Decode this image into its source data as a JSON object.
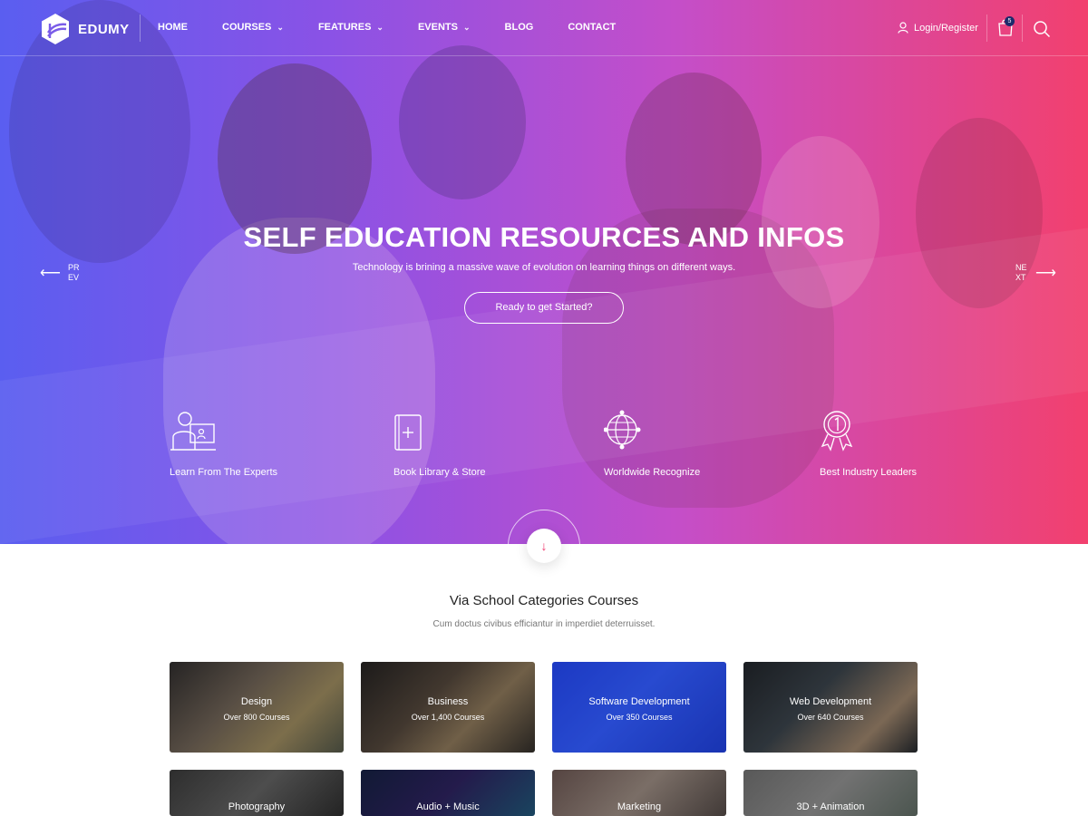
{
  "header": {
    "logo_text": "EDUMY",
    "nav": [
      {
        "label": "HOME",
        "has_dropdown": false
      },
      {
        "label": "COURSES",
        "has_dropdown": true
      },
      {
        "label": "FEATURES",
        "has_dropdown": true
      },
      {
        "label": "EVENTS",
        "has_dropdown": true
      },
      {
        "label": "BLOG",
        "has_dropdown": false
      },
      {
        "label": "CONTACT",
        "has_dropdown": false
      }
    ],
    "login_label": "Login/Register",
    "cart_count": "5"
  },
  "hero": {
    "title": "SELF EDUCATION RESOURCES AND INFOS",
    "subtitle": "Technology is brining a massive wave of evolution on learning things on different ways.",
    "cta_label": "Ready to get Started?",
    "prev_label": "PREV",
    "next_label": "NEXT",
    "features": [
      {
        "label": "Learn From The Experts",
        "icon": "teacher-icon"
      },
      {
        "label": "Book Library & Store",
        "icon": "book-icon"
      },
      {
        "label": "Worldwide Recognize",
        "icon": "globe-icon"
      },
      {
        "label": "Best Industry Leaders",
        "icon": "award-icon"
      }
    ],
    "colors": {
      "gradient_start": "#5a5ef0",
      "gradient_end": "#f2406e",
      "accent": "#f0386e"
    }
  },
  "categories": {
    "title": "Via School Categories Courses",
    "subtitle": "Cum doctus civibus efficiantur in imperdiet deterruisset.",
    "items": [
      {
        "name": "Design",
        "count": "Over 800 Courses"
      },
      {
        "name": "Business",
        "count": "Over 1,400 Courses"
      },
      {
        "name": "Software Development",
        "count": "Over 350 Courses"
      },
      {
        "name": "Web Development",
        "count": "Over 640 Courses"
      },
      {
        "name": "Photography",
        "count": ""
      },
      {
        "name": "Audio + Music",
        "count": ""
      },
      {
        "name": "Marketing",
        "count": ""
      },
      {
        "name": "3D + Animation",
        "count": ""
      }
    ]
  }
}
